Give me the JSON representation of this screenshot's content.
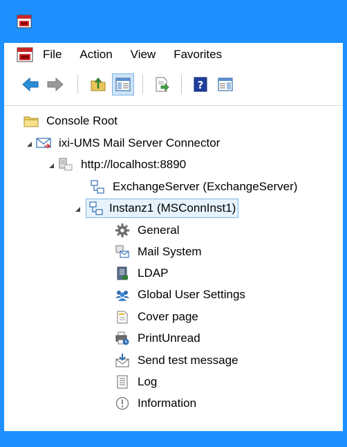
{
  "menubar": {
    "items": [
      {
        "label": "File"
      },
      {
        "label": "Action"
      },
      {
        "label": "View"
      },
      {
        "label": "Favorites"
      }
    ]
  },
  "toolbar": {
    "buttons": [
      {
        "name": "back-arrow-icon"
      },
      {
        "name": "forward-arrow-icon"
      },
      {
        "name": "up-folder-icon"
      },
      {
        "name": "show-hide-tree-icon",
        "active": true
      },
      {
        "name": "export-list-icon"
      },
      {
        "name": "help-icon"
      },
      {
        "name": "action-pane-icon"
      }
    ]
  },
  "tree": {
    "root": "Console Root",
    "connector": "ixi-UMS Mail Server Connector",
    "server": "http://localhost:8890",
    "exchange": "ExchangeServer (ExchangeServer)",
    "instance": "Instanz1 (MSConnInst1)",
    "children": [
      {
        "label": "General",
        "icon": "gear-icon"
      },
      {
        "label": "Mail System",
        "icon": "mail-system-icon"
      },
      {
        "label": "LDAP",
        "icon": "ldap-icon"
      },
      {
        "label": "Global User Settings",
        "icon": "users-icon"
      },
      {
        "label": "Cover page",
        "icon": "cover-page-icon"
      },
      {
        "label": "PrintUnread",
        "icon": "print-unread-icon"
      },
      {
        "label": "Send test message",
        "icon": "send-message-icon"
      },
      {
        "label": "Log",
        "icon": "log-icon"
      },
      {
        "label": "Information",
        "icon": "information-icon"
      }
    ]
  },
  "colors": {
    "accent": "#1e90ff",
    "selection": "#e6f2fc",
    "selection_border": "#7eb4ea"
  }
}
